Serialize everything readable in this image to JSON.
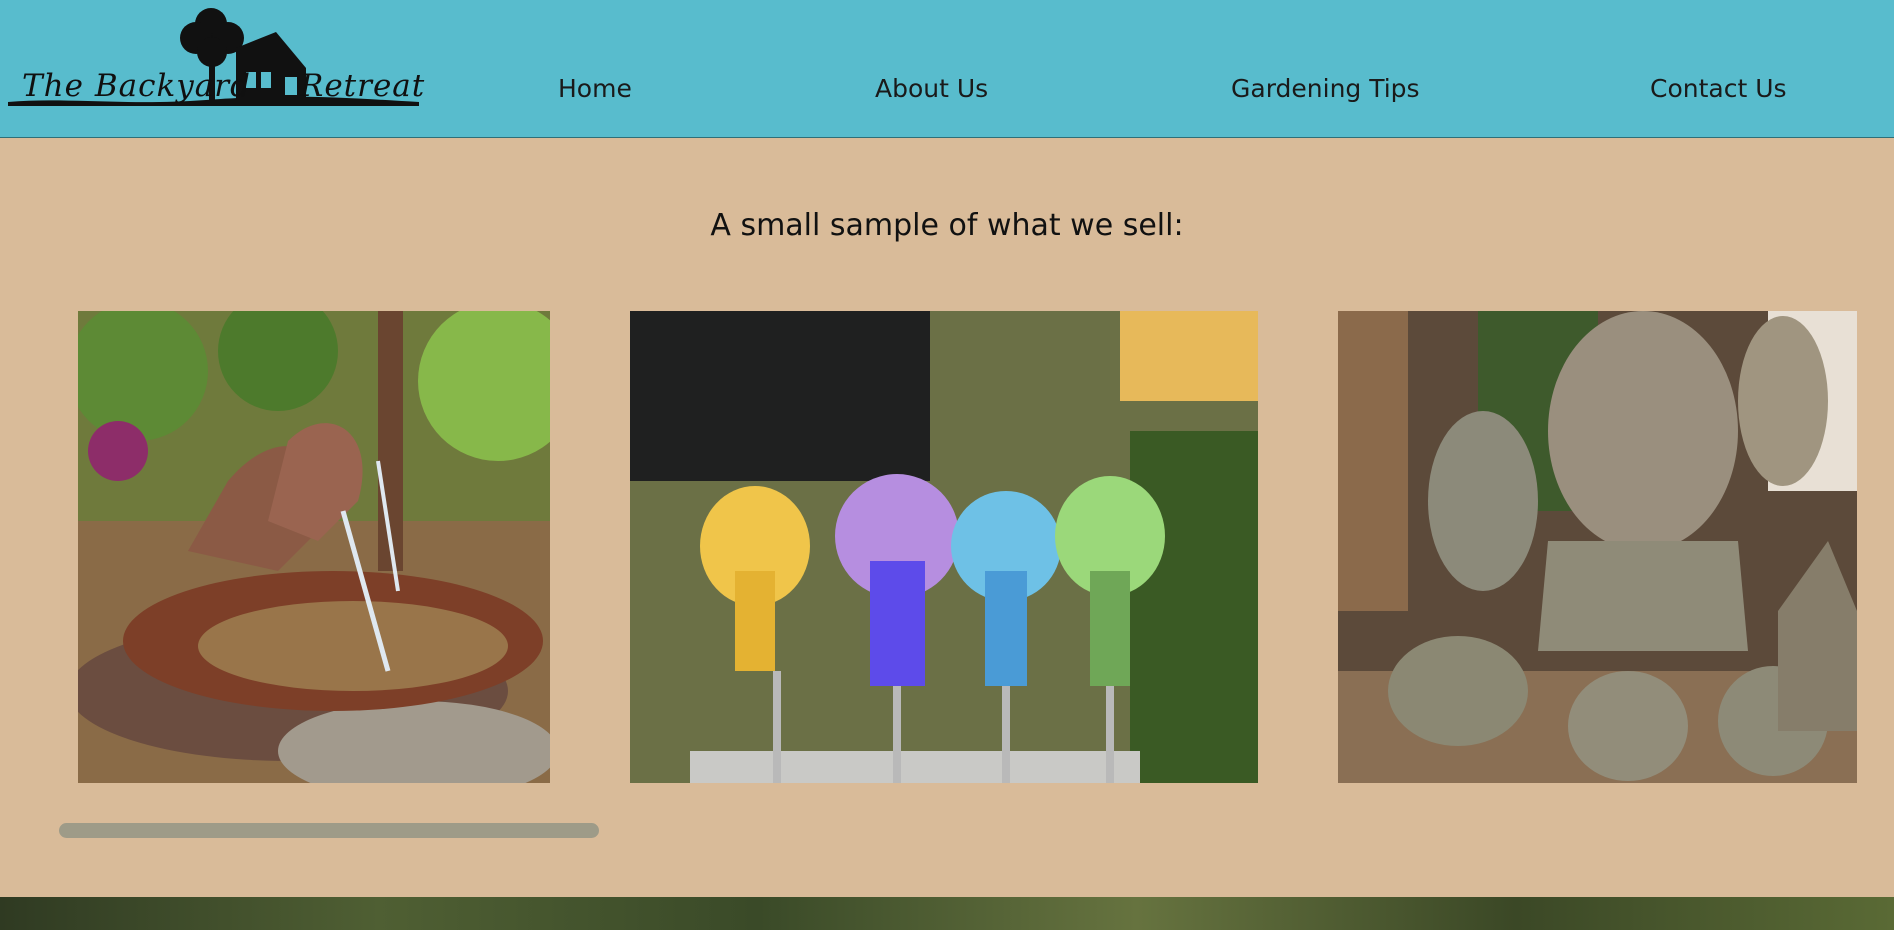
{
  "header": {
    "logo_text_left": "The Backyard",
    "logo_text_right": "Retreat",
    "bg_color": "#58bccd"
  },
  "nav": {
    "items": [
      {
        "label": "Home"
      },
      {
        "label": "About Us"
      },
      {
        "label": "Gardening Tips"
      },
      {
        "label": "Contact Us"
      }
    ]
  },
  "main": {
    "title": "A small sample of what we sell:",
    "gallery": {
      "images": [
        {
          "subject": "rusty bird fountain"
        },
        {
          "subject": "glass angel garden stakes"
        },
        {
          "subject": "stone bust and rabbit statues"
        }
      ],
      "scroll_position": 0
    }
  }
}
